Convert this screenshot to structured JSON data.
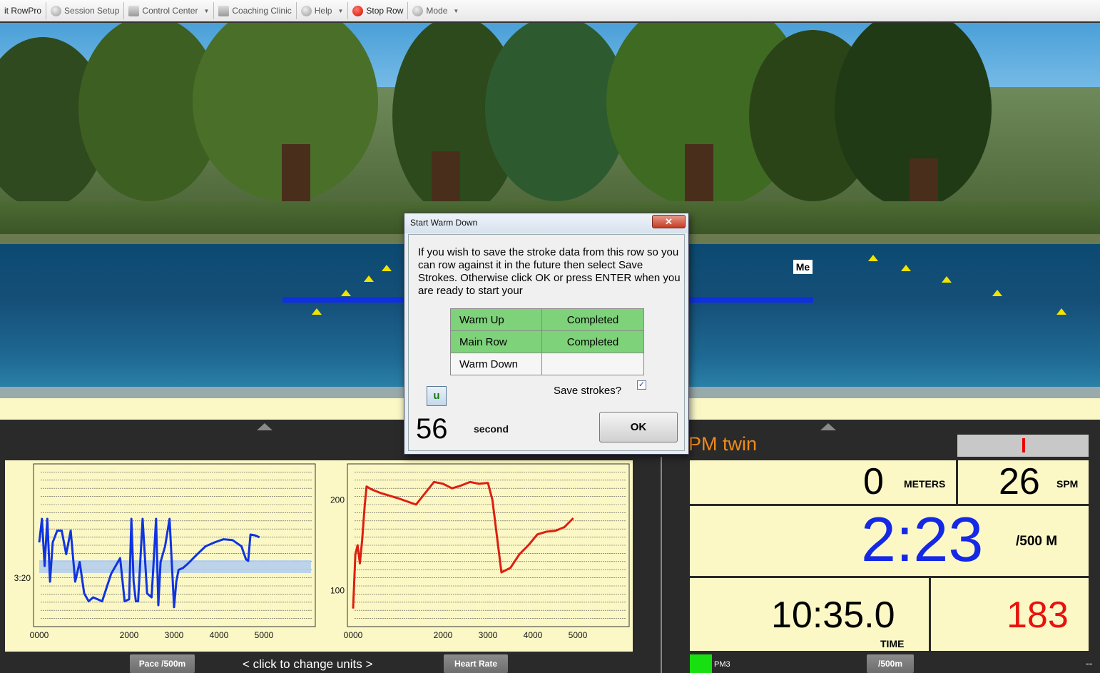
{
  "toolbar": {
    "items": [
      {
        "label": "it RowPro"
      },
      {
        "label": "Session Setup"
      },
      {
        "label": "Control Center"
      },
      {
        "label": "Coaching Clinic"
      },
      {
        "label": "Help"
      },
      {
        "label": "Stop Row"
      },
      {
        "label": "Mode"
      }
    ]
  },
  "race": {
    "me_label": "Me"
  },
  "dialog": {
    "title": "Start Warm Down",
    "close_label": "✕",
    "message": "If you wish to save the stroke data from this row so you can row against it in the future then select Save Strokes.  Otherwise click OK or press ENTER when you are ready to start your",
    "stages": [
      {
        "name": "Warm Up",
        "status": "Completed"
      },
      {
        "name": "Main Row",
        "status": "Completed"
      },
      {
        "name": "Warm Down",
        "status": ""
      }
    ],
    "save_label": "Save strokes?",
    "save_checked": true,
    "u_label": "u",
    "countdown": "56",
    "countdown_unit": "second",
    "ok_label": "OK"
  },
  "charts": {
    "change_units_hint": "<  click to change units  >",
    "left_button": "Pace /500m",
    "right_button": "Heart Rate"
  },
  "chart_data": [
    {
      "type": "line",
      "title": "",
      "series": [
        {
          "color": "#1034e0",
          "x": [
            0,
            60,
            120,
            180,
            240,
            300,
            400,
            500,
            600,
            700,
            800,
            900,
            1000,
            1100,
            1200,
            1400,
            1600,
            1800,
            1900,
            2000,
            2050,
            2100,
            2150,
            2200,
            2300,
            2400,
            2500,
            2600,
            2650,
            2700,
            2800,
            2900,
            3000,
            3050,
            3100,
            3200,
            3300,
            3500,
            3700,
            3900,
            4100,
            4300,
            4500,
            4600,
            4650,
            4700,
            4800,
            4900
          ],
          "y": [
            200,
            140,
            260,
            140,
            300,
            200,
            170,
            170,
            230,
            170,
            300,
            250,
            330,
            350,
            340,
            350,
            280,
            240,
            350,
            345,
            140,
            300,
            350,
            350,
            140,
            330,
            340,
            140,
            360,
            250,
            210,
            140,
            365,
            300,
            270,
            265,
            255,
            232,
            210,
            200,
            192,
            194,
            210,
            243,
            247,
            180,
            182,
            187
          ]
        }
      ],
      "x_ticks": [
        "0000",
        "2000",
        "3000",
        "4000",
        "5000"
      ],
      "y_ticks": [
        "3:20"
      ],
      "target_band": true
    },
    {
      "type": "line",
      "title": "",
      "series": [
        {
          "color": "#dd1f10",
          "x": [
            0,
            50,
            100,
            150,
            200,
            260,
            300,
            400,
            600,
            1000,
            1400,
            1800,
            2000,
            2200,
            2400,
            2600,
            2800,
            3000,
            3100,
            3300,
            3500,
            3700,
            3900,
            4100,
            4300,
            4500,
            4700,
            4900
          ],
          "y": [
            80,
            140,
            150,
            130,
            155,
            195,
            215,
            212,
            208,
            202,
            195,
            220,
            218,
            213,
            216,
            220,
            218,
            219,
            200,
            120,
            125,
            140,
            150,
            162,
            165,
            166,
            170,
            180
          ]
        }
      ],
      "x_ticks": [
        "0000",
        "2000",
        "3000",
        "4000",
        "5000"
      ],
      "y_ticks": [
        "100",
        "200"
      ],
      "ylim": [
        60,
        240
      ]
    }
  ],
  "monitor": {
    "title": "PM twin",
    "meters_value": "0",
    "meters_unit": "METERS",
    "spm_value": "26",
    "spm_unit": "SPM",
    "pace_value": "2:23",
    "pace_unit": "/500 M",
    "time_value": "10:35.0",
    "time_unit": "TIME",
    "hr_value": "183",
    "pm3_label": "PM3",
    "pace_button": "/500m",
    "dash": "--",
    "colors": {
      "pace": "#1428e6",
      "hr": "#e8120c",
      "title": "#f08a1a"
    }
  }
}
